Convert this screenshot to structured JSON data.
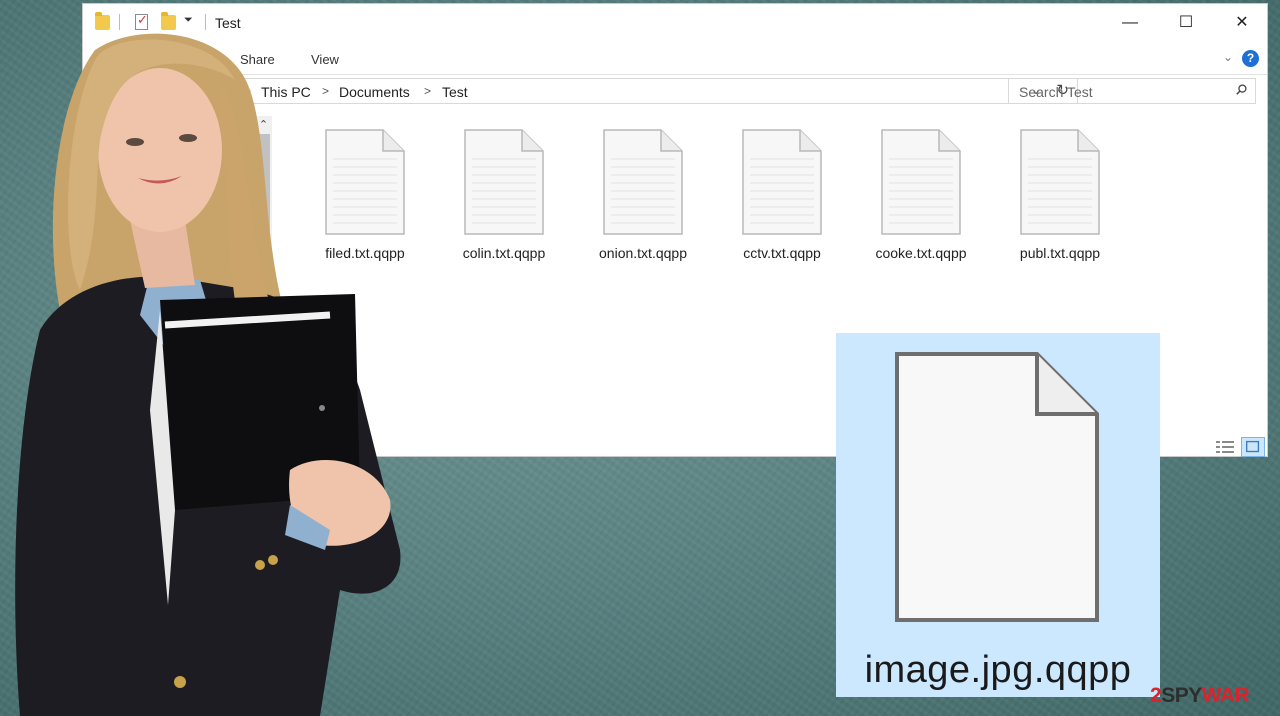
{
  "window": {
    "title": "Test",
    "ribbon_tabs": [
      "Share",
      "View"
    ],
    "controls": {
      "minimize": "—",
      "maximize": "☐",
      "close": "✕"
    },
    "help": "?"
  },
  "address": {
    "crumbs": [
      "This PC",
      "Documents",
      "Test"
    ],
    "search_placeholder": "Search Test"
  },
  "files": [
    {
      "name": "filed.txt.qqpp"
    },
    {
      "name": "colin.txt.qqpp"
    },
    {
      "name": "onion.txt.qqpp"
    },
    {
      "name": "cctv.txt.qqpp"
    },
    {
      "name": "cooke.txt.qqpp"
    },
    {
      "name": "publ.txt.qqpp"
    }
  ],
  "preview": {
    "name": "image.jpg.qqpp"
  },
  "watermark": {
    "num": "2",
    "text": "SPY",
    "accent": "WAR"
  },
  "colors": {
    "selection": "#cce8ff",
    "accent": "#1e6fd6",
    "brand": "#d9232d"
  }
}
